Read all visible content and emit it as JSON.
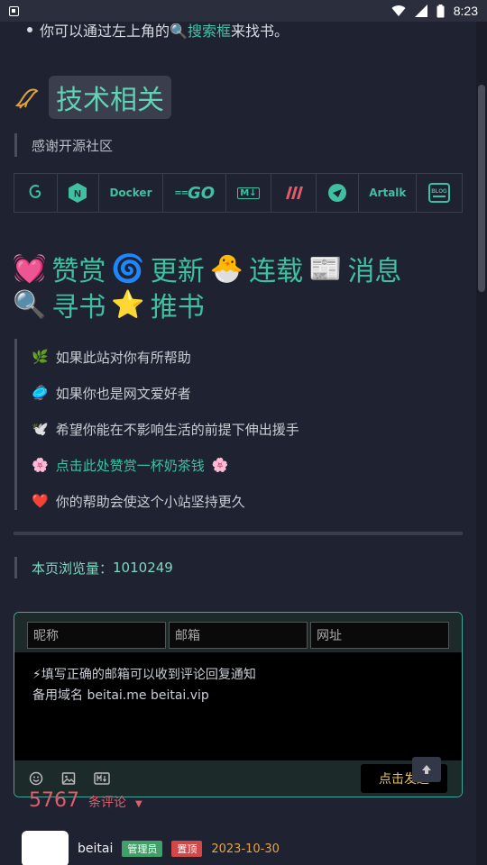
{
  "status_bar": {
    "time": "8:23",
    "left_icon": "a-box-icon",
    "icons": [
      "wifi-icon",
      "signal-icon",
      "battery-icon"
    ]
  },
  "intro": {
    "prefix": "你可以通过左上角的",
    "search_icon": "🔍",
    "link": "搜索框",
    "suffix": "来找书。"
  },
  "tech": {
    "title": "技术相关",
    "quote": "感谢开源社区"
  },
  "logos": {
    "docker": "Docker",
    "go": "GO",
    "markdown": "M↓",
    "artalk": "Artalk",
    "blog": "BLOG"
  },
  "actions": {
    "row1": [
      {
        "emoji": "💓",
        "label": "赞赏"
      },
      {
        "emoji": "🌀",
        "label": "更新"
      },
      {
        "emoji": "🐣",
        "label": "连载"
      },
      {
        "emoji": "📰",
        "label": "消息"
      }
    ],
    "row2": [
      {
        "emoji": "🔍",
        "label": "寻书"
      },
      {
        "emoji": "⭐",
        "label": "推书"
      }
    ]
  },
  "support": [
    {
      "emoji": "🌿",
      "text": "如果此站对你有所帮助"
    },
    {
      "emoji": "🥏",
      "text": "如果你也是网文爱好者"
    },
    {
      "emoji": "🕊️",
      "text": "希望你能在不影响生活的前提下伸出援手"
    },
    {
      "emoji": "🌸",
      "text": "点击此处赞赏一杯奶茶钱",
      "suffix": "🌸"
    },
    {
      "emoji": "❤️",
      "text": "你的帮助会使这个小站坚持更久"
    }
  ],
  "views": {
    "label": "本页浏览量：",
    "value": "1010249"
  },
  "comment_form": {
    "nick_placeholder": "昵称",
    "email_placeholder": "邮箱",
    "url_placeholder": "网址",
    "line1": "⚡填写正确的邮箱可以收到评论回复通知",
    "line2": "备用域名 beitai.me  beitai.vip",
    "send": "点击发送"
  },
  "comments": {
    "count": "5767",
    "label": "条评论",
    "first": {
      "user": "beitai",
      "badge_admin": "管理员",
      "badge_top": "置顶",
      "date": "2023-10-30"
    }
  },
  "colors": {
    "bg": "#1f2230",
    "accent": "#3fc0a0",
    "count": "#e05d6b"
  }
}
